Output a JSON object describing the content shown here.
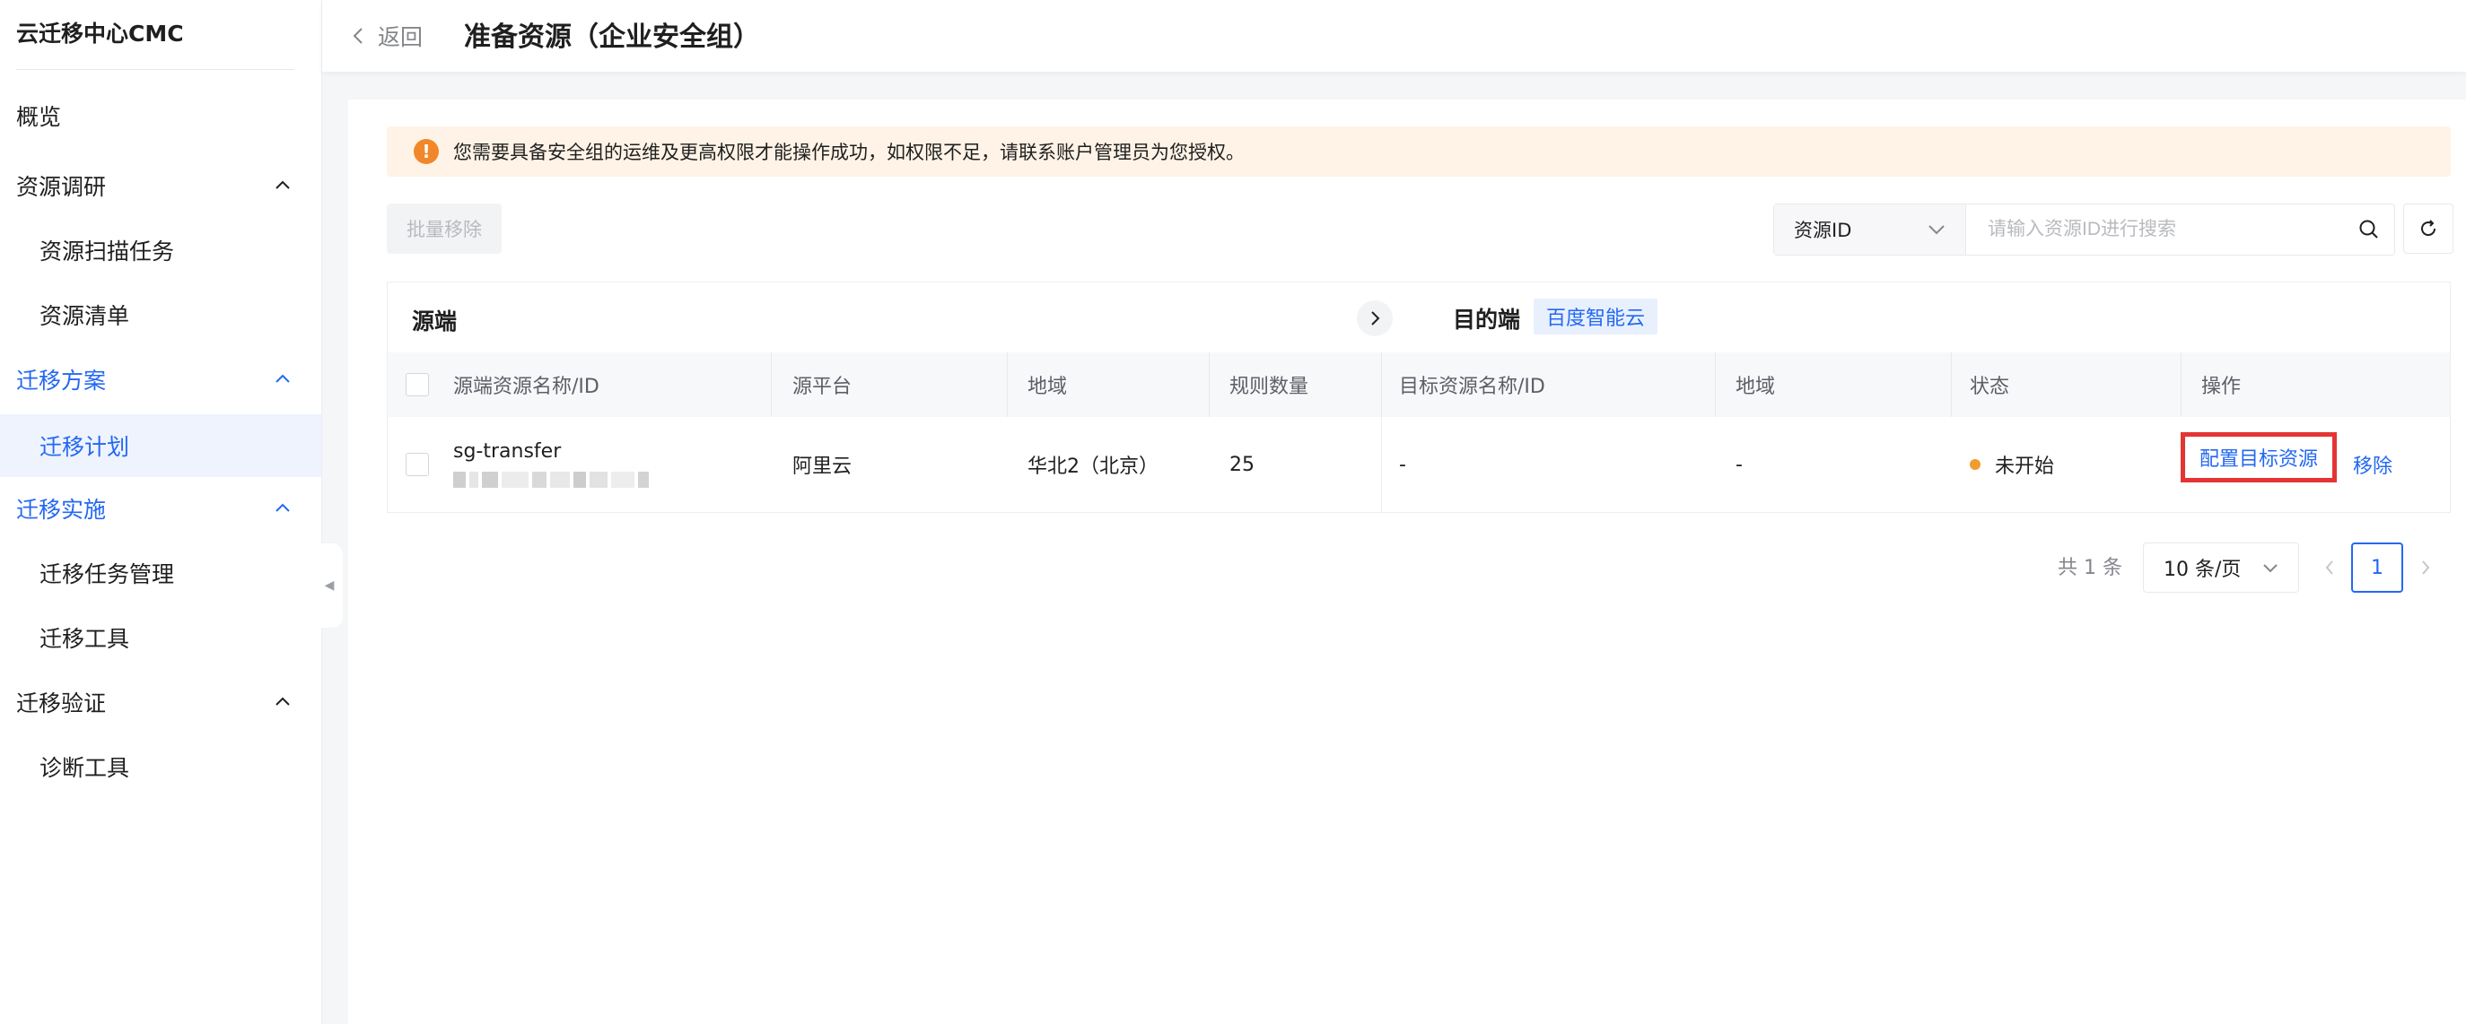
{
  "app": {
    "title": "云迁移中心CMC"
  },
  "sidebar": {
    "items": [
      {
        "label": "概览"
      },
      {
        "label": "资源调研"
      },
      {
        "label": "资源扫描任务"
      },
      {
        "label": "资源清单"
      },
      {
        "label": "迁移方案"
      },
      {
        "label": "迁移计划"
      },
      {
        "label": "迁移实施"
      },
      {
        "label": "迁移任务管理"
      },
      {
        "label": "迁移工具"
      },
      {
        "label": "迁移验证"
      },
      {
        "label": "诊断工具"
      }
    ],
    "collapse_glyph": "◀"
  },
  "header": {
    "back_label": "返回",
    "title": "准备资源（企业安全组）"
  },
  "alert": {
    "icon_glyph": "!",
    "text": "您需要具备安全组的运维及更高权限才能操作成功，如权限不足，请联系账户管理员为您授权。"
  },
  "toolbar": {
    "batch_remove_label": "批量移除",
    "search_field_select": "资源ID",
    "search_placeholder": "请输入资源ID进行搜索"
  },
  "table": {
    "source_group_label": "源端",
    "target_group_label": "目的端",
    "target_platform_badge": "百度智能云",
    "columns": [
      "源端资源名称/ID",
      "源平台",
      "地域",
      "规则数量",
      "目标资源名称/ID",
      "地域",
      "状态",
      "操作"
    ],
    "rows": [
      {
        "name": "sg-transfer",
        "platform": "阿里云",
        "region": "华北2（北京）",
        "rule_count": "25",
        "target_name": "-",
        "target_region": "-",
        "status": "未开始",
        "action_config": "配置目标资源",
        "action_remove": "移除"
      }
    ]
  },
  "pagination": {
    "total_label": "共 1 条",
    "page_size": "10 条/页",
    "current_page": "1"
  },
  "colors": {
    "accent": "#2468f2",
    "warning": "#f2872a",
    "highlight_border": "#e43434",
    "status_pending": "#f29b2e"
  }
}
